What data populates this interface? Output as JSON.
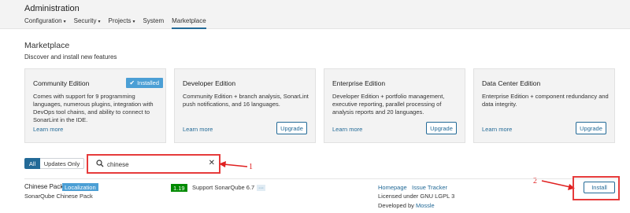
{
  "header": {
    "title": "Administration",
    "nav": [
      {
        "label": "Configuration",
        "caret": "▾"
      },
      {
        "label": "Security",
        "caret": "▾"
      },
      {
        "label": "Projects",
        "caret": "▾"
      },
      {
        "label": "System",
        "caret": ""
      },
      {
        "label": "Marketplace",
        "caret": "",
        "active": true
      }
    ]
  },
  "page": {
    "title": "Marketplace",
    "description": "Discover and install new features"
  },
  "editions": [
    {
      "name": "Community Edition",
      "status": "Installed",
      "description": "Comes with support for 9 programming languages, numerous plugins, integration with DevOps tool chains, and ability to connect to SonarLint in the IDE.",
      "learn_more": "Learn more"
    },
    {
      "name": "Developer Edition",
      "description": "Community Edition + branch analysis, SonarLint push notifications, and 16 languages.",
      "learn_more": "Learn more",
      "action": "Upgrade"
    },
    {
      "name": "Enterprise Edition",
      "description": "Developer Edition + portfolio management, executive reporting, parallel processing of analysis reports and 20 languages.",
      "learn_more": "Learn more",
      "action": "Upgrade"
    },
    {
      "name": "Data Center Edition",
      "description": "Enterprise Edition + component redundancy and data integrity.",
      "learn_more": "Learn more",
      "action": "Upgrade"
    }
  ],
  "filter": {
    "all_label": "All",
    "updates_label": "Updates Only",
    "search_value": "chinese",
    "clear_icon": "✕"
  },
  "annotations": {
    "one": "1",
    "two": "2"
  },
  "plugin": {
    "name": "Chinese Pack",
    "category": "Localization",
    "description": "SonarQube Chinese Pack",
    "version": "1.19",
    "support": "Support SonarQube 6.7",
    "more": "···",
    "homepage": "Homepage",
    "issue_tracker": "Issue Tracker",
    "license": "Licensed under GNU LGPL 3",
    "developed_by": "Developed by ",
    "developer": "Mossle",
    "action": "Install"
  },
  "colors": {
    "accent": "#236a97",
    "badge_blue": "#4b9fd5",
    "version_green": "#008a00",
    "annotation_red": "#e63b3b"
  }
}
